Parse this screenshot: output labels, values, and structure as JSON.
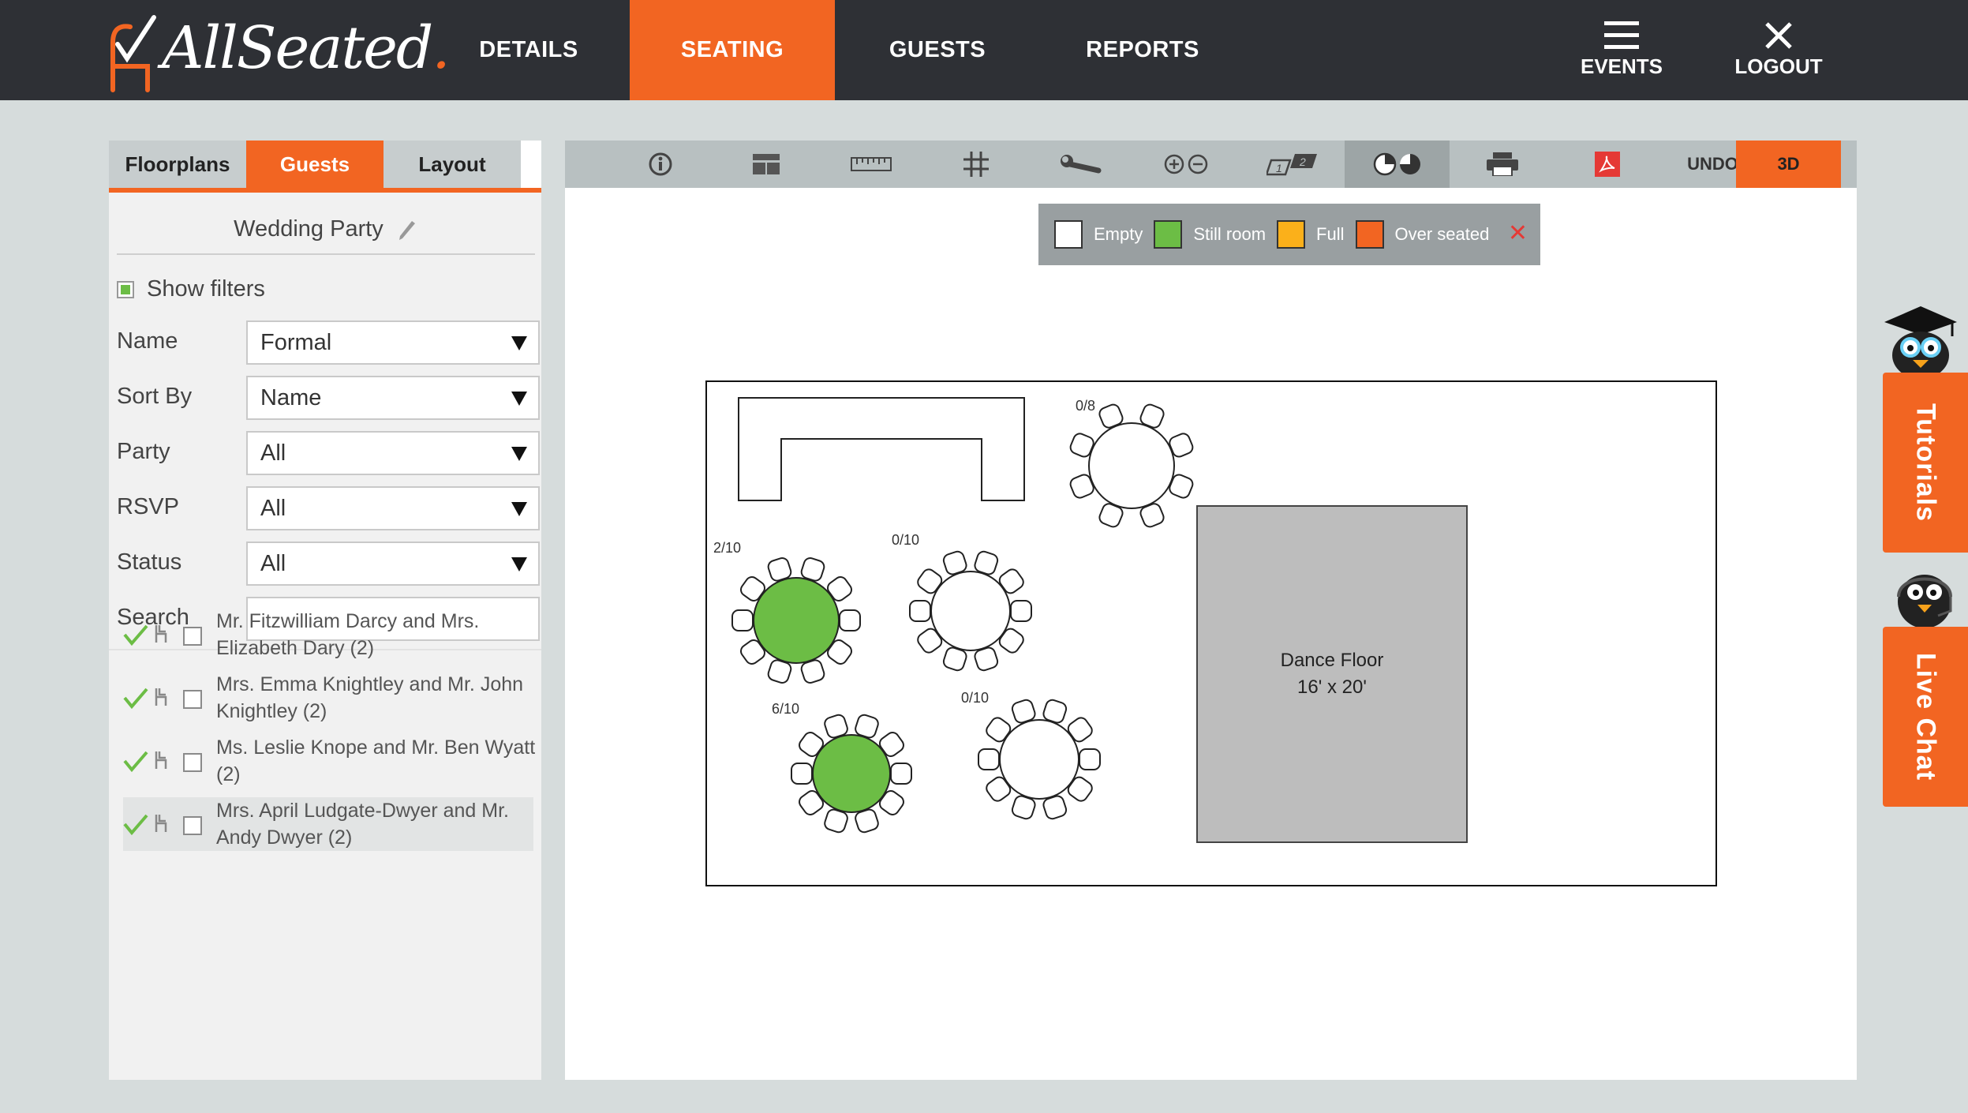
{
  "header": {
    "logo": "AllSeated",
    "nav": [
      "DETAILS",
      "SEATING",
      "GUESTS",
      "REPORTS"
    ],
    "active_nav": "SEATING",
    "events_label": "EVENTS",
    "logout_label": "LOGOUT"
  },
  "left_panel": {
    "tabs": [
      "Floorplans",
      "Guests",
      "Layout"
    ],
    "active_tab": "Guests",
    "party_title": "Wedding Party",
    "show_filters_label": "Show filters",
    "filters": [
      {
        "label": "Name",
        "value": "Formal"
      },
      {
        "label": "Sort By",
        "value": "Name"
      },
      {
        "label": "Party",
        "value": "All"
      },
      {
        "label": "RSVP",
        "value": "All"
      },
      {
        "label": "Status",
        "value": "All"
      }
    ],
    "search_label": "Search",
    "search_value": "",
    "guests": [
      {
        "line1": "Mr. Fitzwilliam Darcy and Mrs.",
        "line2": "Elizabeth Dary (2)"
      },
      {
        "line1": "Mrs. Emma Knightley and Mr. John",
        "line2": "Knightley (2)"
      },
      {
        "line1": "Ms. Leslie Knope and Mr. Ben Wyatt",
        "line2": "(2)"
      },
      {
        "line1": "Mrs. April Ludgate-Dwyer and Mr.",
        "line2": "Andy Dwyer (2)"
      }
    ]
  },
  "toolbar": {
    "icons": [
      "info-icon",
      "table-layout-icon",
      "ruler-icon",
      "grid-icon",
      "wrench-icon",
      "zoom-icon",
      "table-numbers-icon",
      "seating-status-icon",
      "print-icon",
      "pdf-icon"
    ],
    "undo_label": "UNDO",
    "threed_label": "3D"
  },
  "legend": {
    "items": [
      {
        "label": "Empty",
        "color": "#ffffff"
      },
      {
        "label": "Still room",
        "color": "#6cbd45"
      },
      {
        "label": "Full",
        "color": "#fbb01a"
      },
      {
        "label": "Over seated",
        "color": "#f26522"
      }
    ]
  },
  "floorplan": {
    "dance_floor_label": "Dance Floor",
    "dance_floor_size": "16' x 20'",
    "tables": [
      {
        "label": "0/8",
        "seated": 0,
        "capacity": 8
      },
      {
        "label": "2/10",
        "seated": 2,
        "capacity": 10
      },
      {
        "label": "0/10",
        "seated": 0,
        "capacity": 10
      },
      {
        "label": "6/10",
        "seated": 6,
        "capacity": 10
      },
      {
        "label": "0/10",
        "seated": 0,
        "capacity": 10
      }
    ]
  },
  "side_tabs": {
    "tutorials": "Tutorials",
    "live_chat": "Live Chat"
  },
  "colors": {
    "accent": "#f26522",
    "topbar": "#2e3035",
    "still_room": "#6cbd45"
  }
}
